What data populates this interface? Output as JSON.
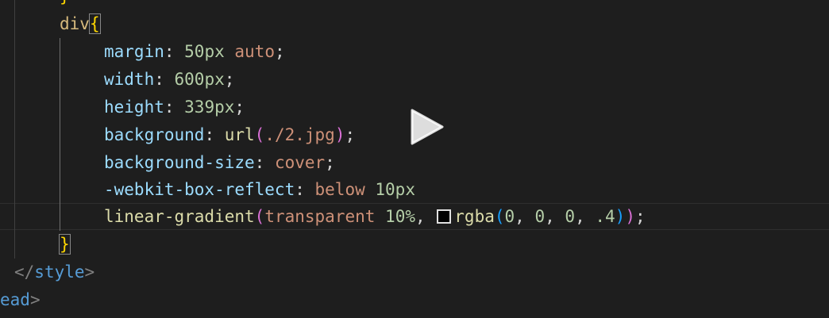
{
  "code": {
    "line_top_brace": "}",
    "selector": "div",
    "open_brace": "{",
    "margin": {
      "prop": "margin",
      "colon": ": ",
      "num": "50px",
      "space": " ",
      "val": "auto",
      "semi": ";"
    },
    "width": {
      "prop": "width",
      "colon": ": ",
      "num": "600px",
      "semi": ";"
    },
    "height": {
      "prop": "height",
      "colon": ": ",
      "num": "339px",
      "semi": ";"
    },
    "background": {
      "prop": "background",
      "colon": ": ",
      "fn": "url",
      "open": "(",
      "val": "./2.jpg",
      "close": ")",
      "semi": ";"
    },
    "background_size": {
      "prop": "background-size",
      "colon": ": ",
      "val": "cover",
      "semi": ";"
    },
    "reflect": {
      "prop": "-webkit-box-reflect",
      "colon": ": ",
      "val": "below",
      "space": " ",
      "num": "10px"
    },
    "gradient": {
      "fn": "linear-gradient",
      "open": "(",
      "val": "transparent",
      "space": " ",
      "num": "10%",
      "comma": ", ",
      "swatch_color": "#000000",
      "rgba_fn": "rgba",
      "rgba_open": "(",
      "rgba_args": [
        "0",
        "0",
        "0",
        ".4"
      ],
      "rgba_close": ")",
      "close": ")",
      "semi": ";"
    },
    "close_brace": "}",
    "style_close": {
      "lt": "</",
      "tag": "style",
      "gt": ">"
    },
    "head_close": {
      "tag": "ead",
      "gt": ">"
    }
  },
  "overlay": {
    "icon": "play-icon"
  },
  "colors": {
    "background": "#1e1e1e",
    "property": "#9cdcfe",
    "number": "#b5cea8",
    "string_value": "#ce9178",
    "function": "#dcdcaa",
    "brace": "#ffd700",
    "html_tag": "#569cd6"
  }
}
